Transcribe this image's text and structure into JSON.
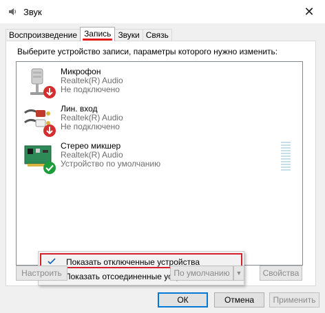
{
  "window": {
    "title": "Звук"
  },
  "tabs": [
    {
      "label": "Воспроизведение"
    },
    {
      "label": "Запись"
    },
    {
      "label": "Звуки"
    },
    {
      "label": "Связь"
    }
  ],
  "instruction": "Выберите устройство записи, параметры которого нужно изменить:",
  "devices": [
    {
      "name": "Микрофон",
      "driver": "Realtek(R) Audio",
      "status": "Не подключено",
      "icon": "microphone-icon",
      "badge": "disconnected-badge-icon"
    },
    {
      "name": "Лин. вход",
      "driver": "Realtek(R) Audio",
      "status": "Не подключено",
      "icon": "line-in-jack-icon",
      "badge": "disconnected-badge-icon"
    },
    {
      "name": "Стерео микшер",
      "driver": "Realtek(R) Audio",
      "status": "Устройство по умолчанию",
      "icon": "sound-card-icon",
      "badge": "default-check-icon"
    }
  ],
  "context_menu": {
    "items": [
      {
        "label": "Показать отключенные устройства",
        "checked": true
      },
      {
        "label": "Показать отсоединенные устройства",
        "checked": true
      }
    ]
  },
  "buttons": {
    "configure": "Настроить",
    "set_default": "По умолчанию",
    "properties": "Свойства",
    "ok": "ОК",
    "cancel": "Отмена",
    "apply": "Применить"
  },
  "colors": {
    "accent": "#0078d7",
    "highlight_red": "#d4202a",
    "disconnect_red": "#d32f2f",
    "default_green": "#1e9e3a"
  }
}
